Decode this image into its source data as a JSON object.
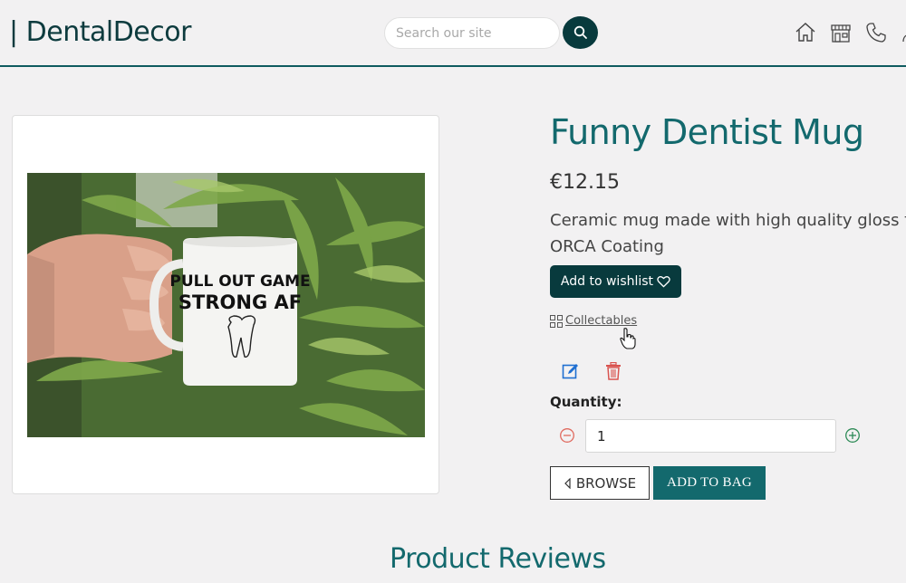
{
  "header": {
    "brand": "| DentalDecor",
    "search_placeholder": "Search our site",
    "icons": [
      "home-icon",
      "store-icon",
      "phone-icon",
      "user-icon"
    ]
  },
  "product": {
    "title": "Funny Dentist Mug",
    "price": "€12.15",
    "description": "Ceramic mug made with high quality gloss finis",
    "description_line2": "ORCA Coating",
    "wishlist_label": "Add to wishlist",
    "collectables_label": "Collectables",
    "quantity_label": "Quantity:",
    "quantity_value": "1",
    "browse_label": "BROWSE",
    "add_to_bag_label": "ADD TO BAG",
    "mug_text_line1": "PULL OUT GAME",
    "mug_text_line2": "STRONG AF"
  },
  "reviews": {
    "title": "Product Reviews"
  },
  "colors": {
    "primary_dark": "#083a3d",
    "primary_teal": "#13696d",
    "danger": "#d9534f",
    "success": "#2e8b57"
  }
}
